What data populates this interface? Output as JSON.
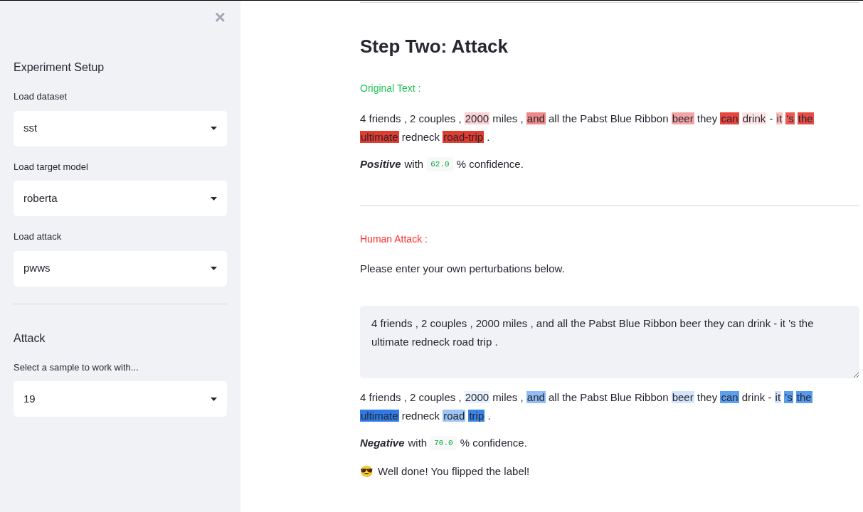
{
  "sidebar": {
    "close_icon": "×",
    "sections": [
      {
        "title": "Experiment Setup",
        "fields": [
          {
            "label": "Load dataset",
            "value": "sst"
          },
          {
            "label": "Load target model",
            "value": "roberta"
          },
          {
            "label": "Load attack",
            "value": "pwws"
          }
        ]
      },
      {
        "title": "Attack",
        "fields": [
          {
            "label": "Select a sample to work with...",
            "value": "19"
          }
        ]
      }
    ]
  },
  "main": {
    "title": "Step Two: Attack",
    "original": {
      "heading": "Original Text :",
      "tokens": [
        {
          "text": "4 friends , 2 couples ,"
        },
        {
          "text": "2000",
          "color": "#f9d3d3"
        },
        {
          "text": "miles ,"
        },
        {
          "text": "and",
          "color": "#ee8a8a"
        },
        {
          "text": "all the Pabst Blue Ribbon"
        },
        {
          "text": "beer",
          "color": "#f3a5a5"
        },
        {
          "text": "they"
        },
        {
          "text": "can",
          "color": "#e8463e"
        },
        {
          "text": "drink",
          "color": "#fde4e4"
        },
        {
          "text": "-"
        },
        {
          "text": "it",
          "color": "#f7c0c0"
        },
        {
          "text": "'s",
          "color": "#ea5a55"
        },
        {
          "text": "the",
          "color": "#e54d45"
        },
        {
          "text": "ultimate",
          "color": "#e23b30"
        },
        {
          "text": "redneck"
        },
        {
          "text": "road-trip",
          "color": "#e23b30"
        },
        {
          "text": "."
        }
      ],
      "label": "Positive",
      "suffix": "with",
      "confidence": "62.0",
      "after": "% confidence."
    },
    "human": {
      "heading": "Human Attack :",
      "instruction": "Please enter your own perturbations below.",
      "input_value": "4 friends , 2 couples , 2000 miles , and all the Pabst Blue Ribbon beer they can drink - it 's the ultimate redneck road trip .",
      "tokens": [
        {
          "text": "4 friends , 2 couples ,"
        },
        {
          "text": "2000",
          "color": "#e8f1fd"
        },
        {
          "text": "miles ,"
        },
        {
          "text": "and",
          "color": "#90bdf5"
        },
        {
          "text": "all the Pabst Blue Ribbon"
        },
        {
          "text": "beer",
          "color": "#d3e5fb"
        },
        {
          "text": "they"
        },
        {
          "text": "can",
          "color": "#5ea0ee"
        },
        {
          "text": "drink - "
        },
        {
          "text": "it",
          "color": "#cfe2fb"
        },
        {
          "text": "'s",
          "color": "#5c9eee"
        },
        {
          "text": "the",
          "color": "#5799ec"
        },
        {
          "text": "ultimate",
          "color": "#2f7ae5"
        },
        {
          "text": "redneck"
        },
        {
          "text": "road",
          "color": "#9cc5f5"
        },
        {
          "text": "trip",
          "color": "#3a84e8"
        },
        {
          "text": "."
        }
      ],
      "label": "Negative",
      "suffix": "with",
      "confidence": "70.0",
      "after": "% confidence.",
      "emoji": "😎",
      "result": "Well done! You flipped the label!"
    }
  }
}
